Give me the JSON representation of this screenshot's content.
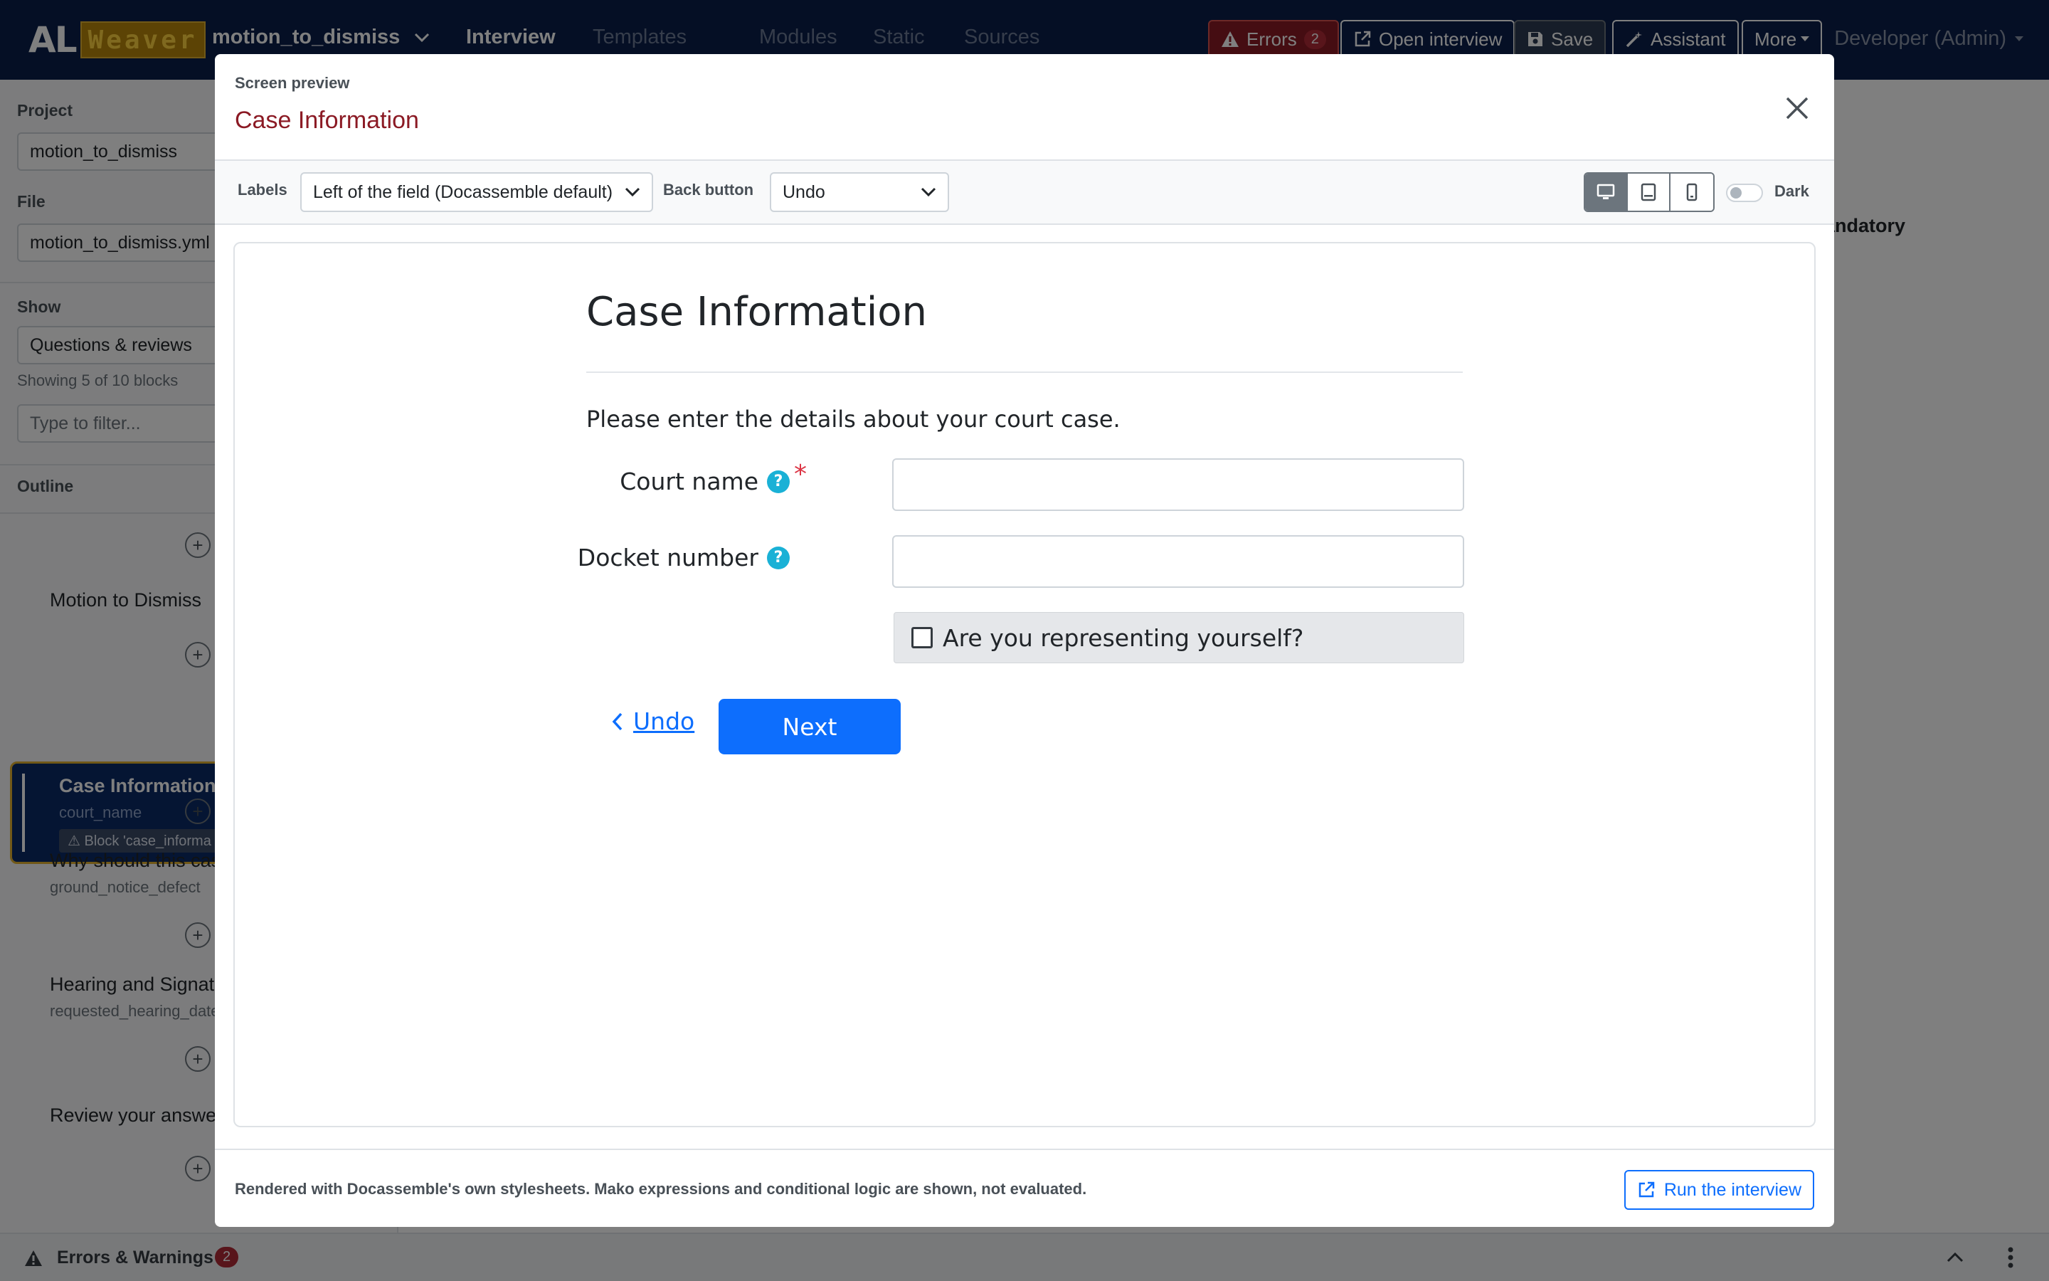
{
  "navbar": {
    "logo_text": "AL",
    "logo_box_text": "Weaver",
    "project_name": "motion_to_dismiss",
    "tabs": [
      {
        "label": "Interview"
      },
      {
        "label": "Templates"
      },
      {
        "label": "Modules"
      },
      {
        "label": "Static"
      },
      {
        "label": "Sources"
      }
    ],
    "errors_label": "Errors",
    "errors_count": "2",
    "open_interview_label": "Open interview",
    "save_label": "Save",
    "assistant_label": "Assistant",
    "more_label": "More",
    "user_label": "Developer (Admin)"
  },
  "sidebar": {
    "project_label": "Project",
    "project_value": "motion_to_dismiss",
    "file_label": "File",
    "file_value": "motion_to_dismiss.yml",
    "show_label": "Show",
    "show_value": "Questions & reviews",
    "showing_text": "Showing 5 of 10 blocks",
    "filter_placeholder": "Type to filter...",
    "outline_label": "Outline",
    "items": [
      {
        "title": "Motion to Dismiss",
        "sub": ""
      },
      {
        "title": "Case Information",
        "sub": "court_name",
        "warning": "Block 'case_informa"
      },
      {
        "title": "Why should this cas",
        "sub": "ground_notice_defect"
      },
      {
        "title": "Hearing and Signatu",
        "sub": "requested_hearing_date"
      },
      {
        "title": "Review your answer",
        "sub": ""
      }
    ]
  },
  "background": {
    "mandatory_text": "andatory"
  },
  "modal": {
    "kicker": "Screen preview",
    "title": "Case Information",
    "labels_label": "Labels",
    "labels_value": "Left of the field (Docassemble default)",
    "back_button_label": "Back button",
    "back_button_value": "Undo",
    "dark_label": "Dark",
    "footer_note": "Rendered with Docassemble's own stylesheets. Mako expressions and conditional logic are shown, not evaluated.",
    "run_label": "Run the interview"
  },
  "question": {
    "title": "Case Information",
    "subquestion": "Please enter the details about your court case.",
    "fields": [
      {
        "label": "Court name",
        "required": "*"
      },
      {
        "label": "Docket number",
        "required": ""
      }
    ],
    "checkbox_label": "Are you representing yourself?",
    "undo_label": "Undo",
    "next_label": "Next",
    "help_glyph": "?"
  },
  "bottom_bar": {
    "label": "Errors & Warnings",
    "count": "2"
  },
  "colors": {
    "navbar": "#0a1f4a",
    "accent": "#0d6efd",
    "title_red": "#8b1a24",
    "help": "#1ab1d6",
    "error": "#b02a37"
  }
}
